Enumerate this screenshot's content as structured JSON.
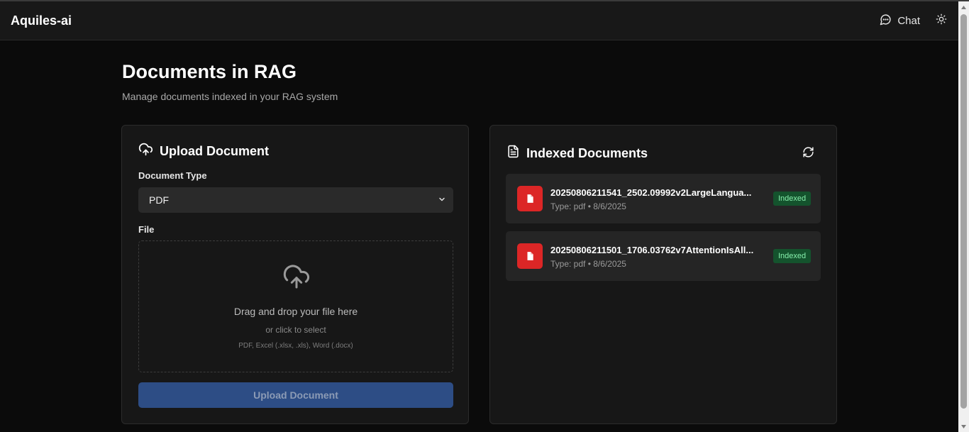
{
  "app": {
    "brand": "Aquiles-ai"
  },
  "header": {
    "chat_label": "Chat",
    "icons": [
      "chat-icon",
      "sun-icon"
    ]
  },
  "page": {
    "title": "Documents in RAG",
    "subtitle": "Manage documents indexed in your RAG system"
  },
  "upload": {
    "title": "Upload Document",
    "doc_type_label": "Document Type",
    "doc_type_value": "PDF",
    "file_label": "File",
    "drop_main": "Drag and drop your file here",
    "drop_sub": "or click to select",
    "drop_formats": "PDF, Excel (.xlsx, .xls), Word (.docx)",
    "button_label": "Upload Document"
  },
  "indexed": {
    "title": "Indexed Documents",
    "documents": [
      {
        "name": "20250806211541_2502.09992v2LargeLangua...",
        "meta": "Type: pdf • 8/6/2025",
        "status": "Indexed"
      },
      {
        "name": "20250806211501_1706.03762v7AttentionIsAll...",
        "meta": "Type: pdf • 8/6/2025",
        "status": "Indexed"
      }
    ]
  },
  "colors": {
    "accent_button": "#2d4d85",
    "pdf_badge": "#dc2626",
    "status_bg": "#14532d",
    "status_text": "#86efac"
  }
}
